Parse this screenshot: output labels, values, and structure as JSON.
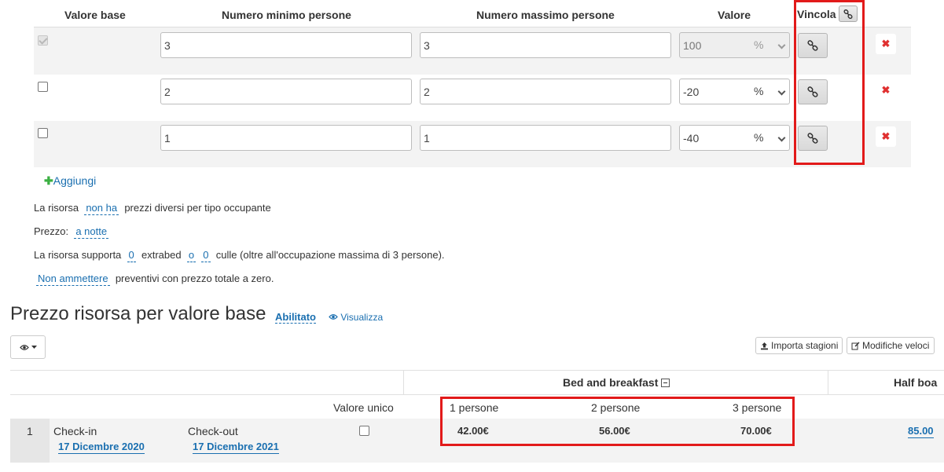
{
  "occupancy_table": {
    "headers": {
      "base_value": "Valore base",
      "min_persons": "Numero minimo persone",
      "max_persons": "Numero massimo persone",
      "value": "Valore",
      "link": "Vincola"
    },
    "rows": [
      {
        "base_checked": true,
        "base_disabled": true,
        "min": "3",
        "max": "3",
        "value": "100",
        "unit": "%",
        "value_readonly": true
      },
      {
        "base_checked": false,
        "base_disabled": false,
        "min": "2",
        "max": "2",
        "value": "-20",
        "unit": "%",
        "value_readonly": false
      },
      {
        "base_checked": false,
        "base_disabled": false,
        "min": "1",
        "max": "1",
        "value": "-40",
        "unit": "%",
        "value_readonly": false
      }
    ],
    "delete_symbol": "✖",
    "add_label": "Aggiungi",
    "add_symbol": "✚"
  },
  "settings": {
    "line1": {
      "prefix": "La risorsa",
      "link": "non ha",
      "suffix": "prezzi diversi per tipo occupante"
    },
    "line2": {
      "prefix": "Prezzo:",
      "link": "a notte"
    },
    "line3": {
      "prefix": "La risorsa supporta",
      "link1": "0",
      "mid1": "extrabed",
      "link2": "o",
      "link3": "0",
      "suffix": "culle (oltre all'occupazione massima di 3 persone)."
    },
    "line4": {
      "link": "Non ammettere",
      "suffix": "preventivi con prezzo totale a zero."
    }
  },
  "price_section": {
    "title": "Prezzo risorsa per valore base",
    "status_link": "Abilitato",
    "view_link": "Visualizza",
    "import_button": "Importa stagioni",
    "quick_edit_button": "Modifiche veloci",
    "plan_bb": "Bed and breakfast",
    "plan_half": "Half boa",
    "unique_value_label": "Valore unico",
    "person_cols": [
      "1 persone",
      "2 persone",
      "3 persone"
    ],
    "row": {
      "index": "1",
      "checkin_label": "Check-in",
      "checkin_date": "17 Dicembre 2020",
      "checkout_label": "Check-out",
      "checkout_date": "17 Dicembre 2021",
      "prices": [
        "42.00€",
        "56.00€",
        "70.00€"
      ],
      "half_price": "85.00"
    }
  },
  "colors": {
    "highlight": "#e21a1a",
    "link": "#1a6fb0",
    "add_green": "#3cb043",
    "delete_red": "#e03030",
    "row_stripe": "#f3f3f3"
  }
}
